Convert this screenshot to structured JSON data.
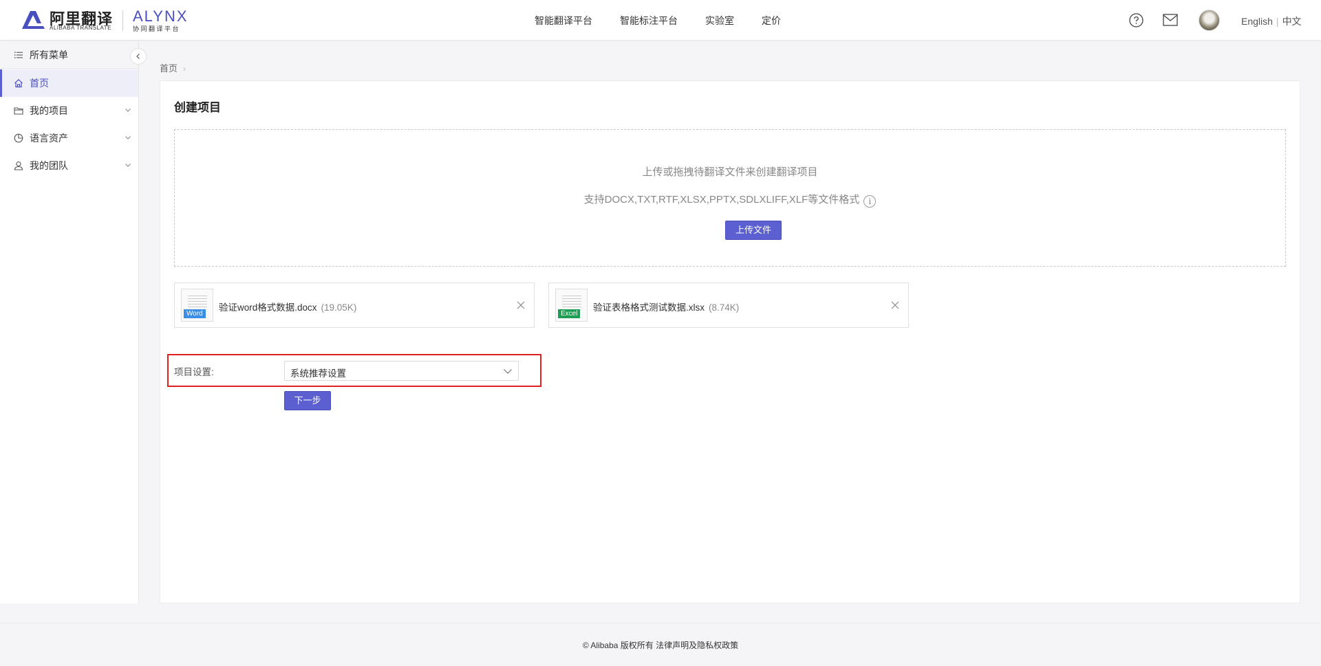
{
  "header": {
    "logo_cn": "阿里翻译",
    "logo_en": "ALIBABA TRANSLATE",
    "brand": "ALYNX",
    "brand_sub": "协同翻译平台",
    "nav": [
      "智能翻译平台",
      "智能标注平台",
      "实验室",
      "定价"
    ],
    "lang_en": "English",
    "lang_sep": "|",
    "lang_cn": "中文",
    "accent": "#5b5fcf"
  },
  "sidebar": {
    "items": [
      {
        "label": "所有菜单",
        "icon": "menu-list-icon"
      },
      {
        "label": "首页",
        "icon": "home-icon"
      },
      {
        "label": "我的项目",
        "icon": "folder-icon"
      },
      {
        "label": "语言资产",
        "icon": "pie-chart-icon"
      },
      {
        "label": "我的团队",
        "icon": "user-icon"
      }
    ]
  },
  "breadcrumb": {
    "home": "首页",
    "arrow": "›"
  },
  "main": {
    "title": "创建项目",
    "dropzone": {
      "line1": "上传或拖拽待翻译文件来创建翻译项目",
      "line2": "支持DOCX,TXT,RTF,XLSX,PPTX,SDLXLIFF,XLF等文件格式",
      "info": "i",
      "upload_button": "上传文件"
    },
    "files": [
      {
        "type": "Word",
        "name": "验证word格式数据.docx",
        "size": "(19.05K)",
        "color": "#3a8ee6"
      },
      {
        "type": "Excel",
        "name": "验证表格格式测试数据.xlsx",
        "size": "(8.74K)",
        "color": "#1e9e52"
      }
    ],
    "settings": {
      "label": "项目设置:",
      "value": "系统推荐设置"
    },
    "next_button": "下一步"
  },
  "footer": {
    "text": "© Alibaba 版权所有 法律声明及隐私权政策"
  }
}
